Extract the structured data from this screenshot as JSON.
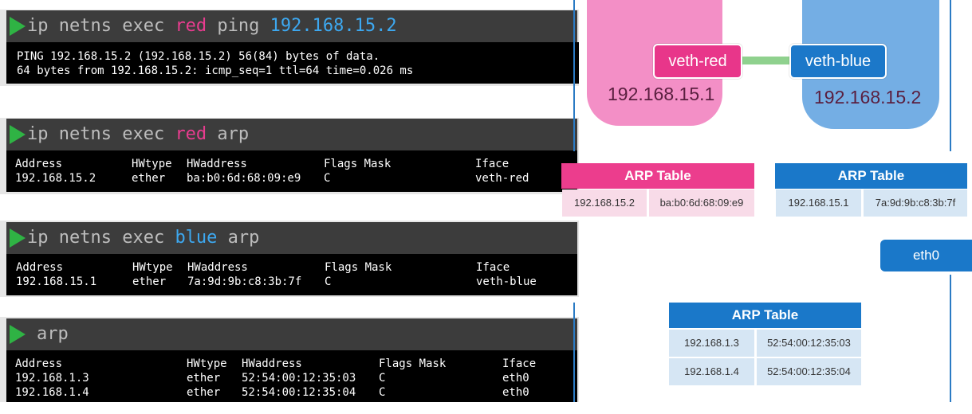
{
  "panel1": {
    "cmd_prefix": "ip netns exec ",
    "cmd_ns": "red",
    "cmd_action": " ping ",
    "cmd_target": "192.168.15.2",
    "output_line1": "PING 192.168.15.2 (192.168.15.2) 56(84) bytes of data.",
    "output_line2": "64 bytes from 192.168.15.2: icmp_seq=1 ttl=64 time=0.026 ms"
  },
  "panel2": {
    "cmd_prefix": "ip netns exec ",
    "cmd_ns": "red",
    "cmd_action": " arp",
    "headers": [
      "Address",
      "HWtype",
      "HWaddress",
      "Flags Mask",
      "Iface"
    ],
    "rows": [
      [
        "192.168.15.2",
        "ether",
        "ba:b0:6d:68:09:e9",
        "C",
        "veth-red"
      ]
    ]
  },
  "panel3": {
    "cmd_prefix": "ip netns exec ",
    "cmd_ns": "blue",
    "cmd_action": " arp",
    "headers": [
      "Address",
      "HWtype",
      "HWaddress",
      "Flags Mask",
      "Iface"
    ],
    "rows": [
      [
        "192.168.15.1",
        "ether",
        "7a:9d:9b:c8:3b:7f",
        "C",
        "veth-blue"
      ]
    ]
  },
  "panel4": {
    "cmd": "arp",
    "headers": [
      "Address",
      "HWtype",
      "HWaddress",
      "Flags Mask",
      "Iface"
    ],
    "rows": [
      [
        "192.168.1.3",
        "ether",
        "52:54:00:12:35:03",
        "C",
        "eth0"
      ],
      [
        "192.168.1.4",
        "ether",
        "52:54:00:12:35:04",
        "C",
        "eth0"
      ]
    ]
  },
  "diagram": {
    "red_ns": {
      "veth": "veth-red",
      "ip": "192.168.15.1",
      "color": "#f38fc6"
    },
    "blue_ns": {
      "veth": "veth-blue",
      "ip": "192.168.15.2",
      "color": "#74aee4"
    },
    "arp_red": {
      "title": "ARP Table",
      "row": [
        "192.168.15.2",
        "ba:b0:6d:68:09:e9"
      ],
      "color": "#ec3d8d"
    },
    "arp_blue": {
      "title": "ARP Table",
      "row": [
        "192.168.15.1",
        "7a:9d:9b:c8:3b:7f"
      ],
      "color": "#1a78c9"
    },
    "eth0": "eth0",
    "arp_host": {
      "title": "ARP Table",
      "rows": [
        [
          "192.168.1.3",
          "52:54:00:12:35:03"
        ],
        [
          "192.168.1.4",
          "52:54:00:12:35:04"
        ]
      ],
      "color": "#1a78c9"
    }
  }
}
